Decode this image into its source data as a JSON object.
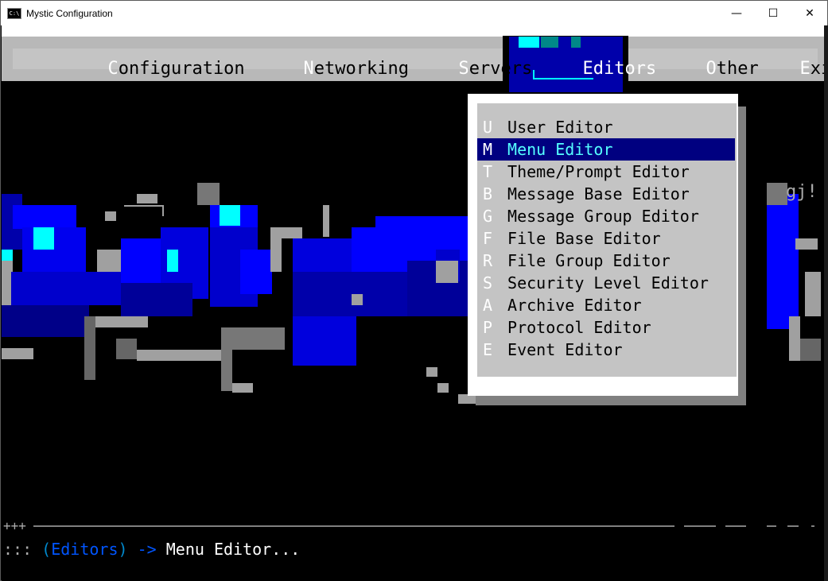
{
  "window": {
    "title": "Mystic Configuration",
    "icon_label": "C:\\",
    "minimize_glyph": "—",
    "maximize_glyph": "☐",
    "close_glyph": "✕"
  },
  "menubar": {
    "items": [
      {
        "hot": "C",
        "rest": "onfiguration"
      },
      {
        "hot": "N",
        "rest": "etworking"
      },
      {
        "hot": "S",
        "rest": "ervers"
      },
      {
        "hot": "E",
        "rest": "ditors"
      },
      {
        "hot": "O",
        "rest": "ther"
      },
      {
        "hot": "E",
        "rest": "xit"
      }
    ],
    "active_index": 3
  },
  "dropdown": {
    "items": [
      {
        "key": "U",
        "label": "User Editor"
      },
      {
        "key": "M",
        "label": "Menu Editor"
      },
      {
        "key": "T",
        "label": "Theme/Prompt Editor"
      },
      {
        "key": "B",
        "label": "Message Base Editor"
      },
      {
        "key": "G",
        "label": "Message Group Editor"
      },
      {
        "key": "F",
        "label": "File Base Editor"
      },
      {
        "key": "R",
        "label": "File Group Editor"
      },
      {
        "key": "S",
        "label": "Security Level Editor"
      },
      {
        "key": "A",
        "label": "Archive Editor"
      },
      {
        "key": "P",
        "label": "Protocol Editor"
      },
      {
        "key": "E",
        "label": "Event Editor"
      }
    ],
    "selected_index": 1
  },
  "art": {
    "right_fragment": "gj!"
  },
  "status": {
    "marks": "+++",
    "prefix": ":::",
    "open": "(",
    "section": "Editors",
    "close": ")",
    "arrow": "->",
    "message": "Menu Editor..."
  },
  "colors": {
    "menu_bg": "#c4c4c4",
    "active_bg": "#0000aa",
    "selected_bg": "#000080",
    "selected_fg": "#55ffff",
    "art_blue": "#0000ff",
    "art_cyan": "#00ffff"
  }
}
